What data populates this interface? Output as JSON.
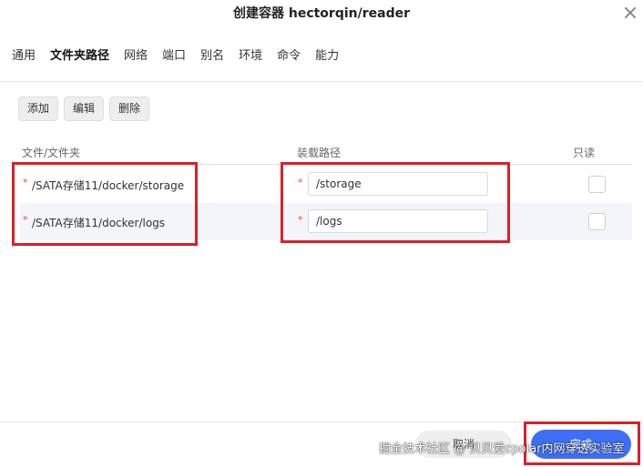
{
  "dialog": {
    "title": "创建容器 hectorqin/reader"
  },
  "tabs": [
    {
      "label": "通用"
    },
    {
      "label": "文件夹路径"
    },
    {
      "label": "网络"
    },
    {
      "label": "端口"
    },
    {
      "label": "别名"
    },
    {
      "label": "环境"
    },
    {
      "label": "命令"
    },
    {
      "label": "能力"
    }
  ],
  "toolbar": {
    "add": "添加",
    "edit": "编辑",
    "delete": "删除"
  },
  "table": {
    "headers": {
      "source": "文件/文件夹",
      "mount": "装载路径",
      "readonly": "只读"
    },
    "rows": [
      {
        "required": "*",
        "source": "/SATA存储11/docker/storage",
        "mount": "/storage",
        "readonly": false
      },
      {
        "required": "*",
        "source": "/SATA存储11/docker/logs",
        "mount": "/logs",
        "readonly": false
      }
    ]
  },
  "footer": {
    "cancel": "取消",
    "confirm": "完成",
    "watermark": "掘金技术社区 @ 贝贝爱cpolar内网穿透实验室"
  },
  "colors": {
    "accent": "#3d6ef5",
    "highlight": "#d8212a",
    "required": "#e84a4a"
  }
}
